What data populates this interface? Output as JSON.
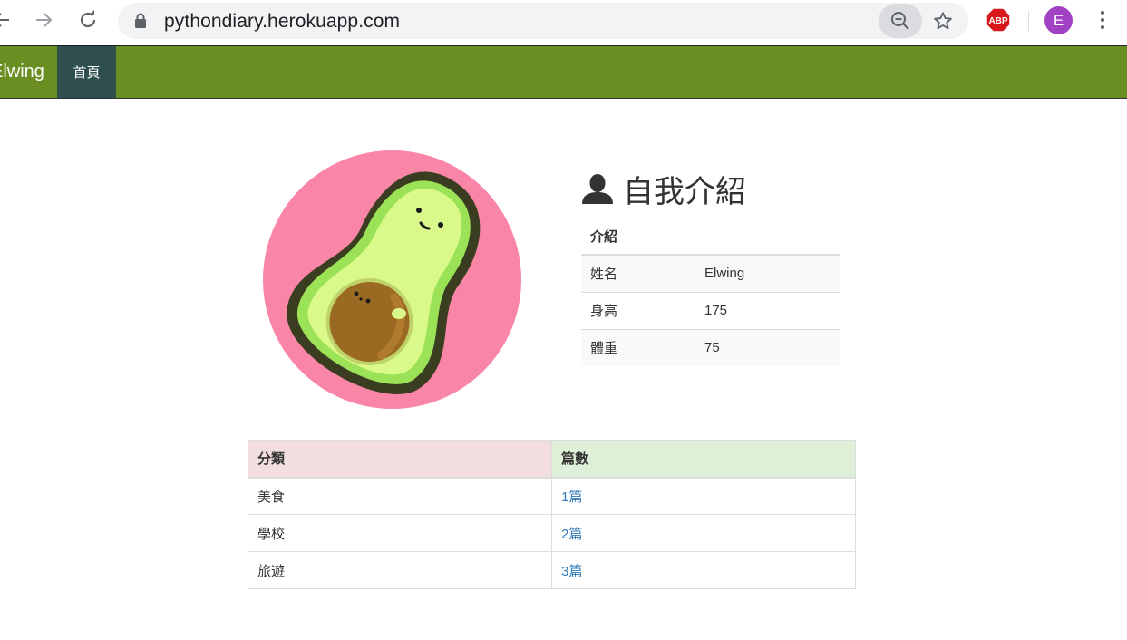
{
  "browser": {
    "url": "pythondiary.herokuapp.com",
    "profile_initial": "E",
    "adblock_label": "ABP"
  },
  "navbar": {
    "brand": "Elwing",
    "home_label": "首頁",
    "color": "#6b8e23",
    "active_color": "#2f4f4f"
  },
  "profile": {
    "heading": "自我介紹",
    "table": {
      "header": "介紹",
      "rows": [
        {
          "label": "姓名",
          "value": "Elwing"
        },
        {
          "label": "身高",
          "value": "175"
        },
        {
          "label": "體重",
          "value": "75"
        }
      ]
    }
  },
  "categories": {
    "headers": [
      "分類",
      "篇數"
    ],
    "rows": [
      {
        "name": "美食",
        "count": "1篇"
      },
      {
        "name": "學校",
        "count": "2篇"
      },
      {
        "name": "旅遊",
        "count": "3篇"
      }
    ]
  }
}
